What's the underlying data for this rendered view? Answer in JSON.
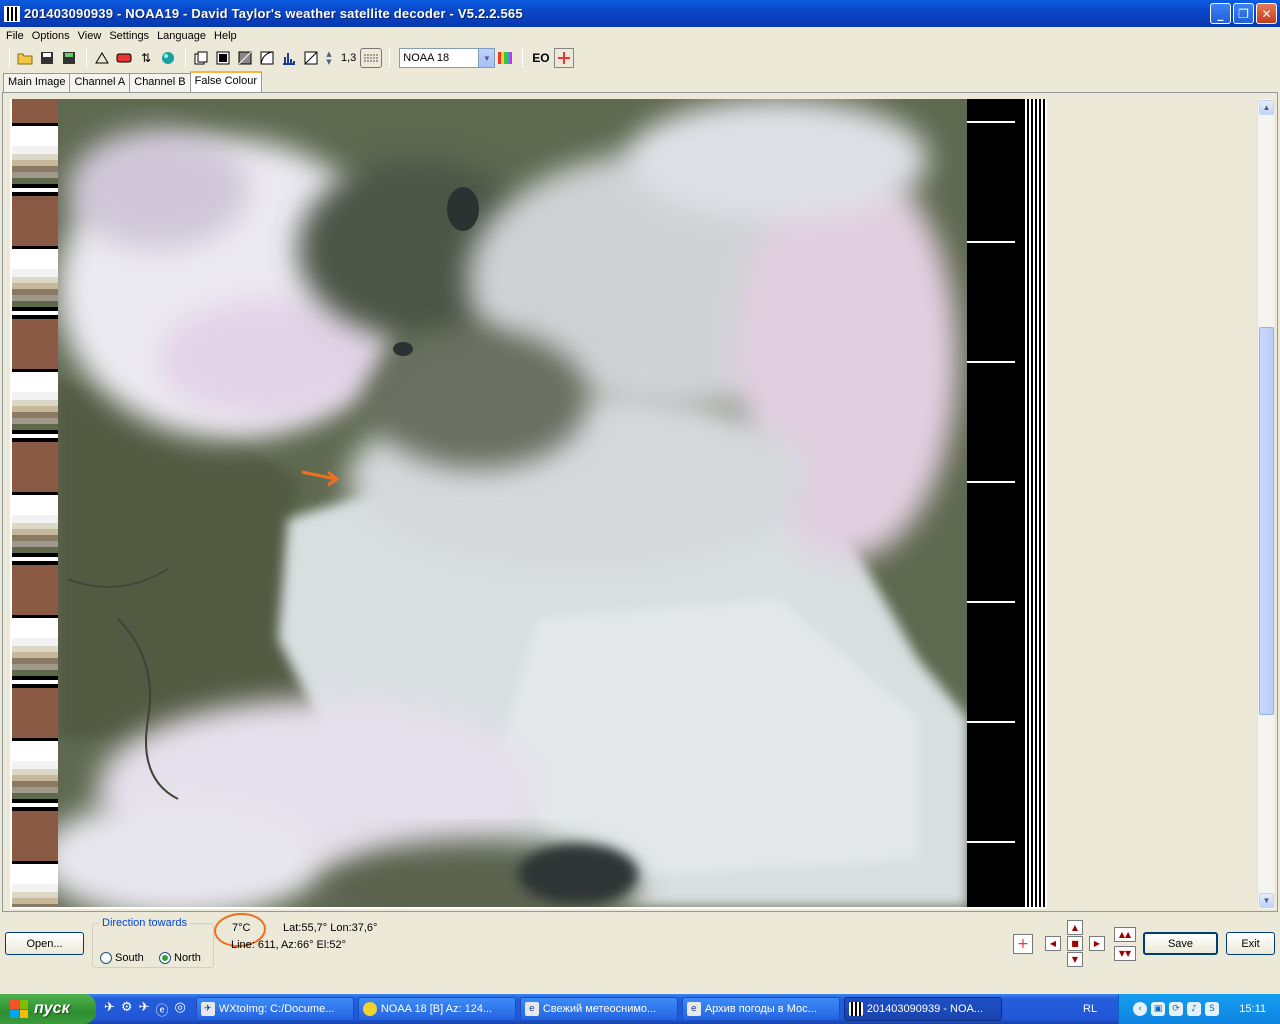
{
  "window": {
    "title": "201403090939 - NOAA19 - David Taylor's weather satellite decoder - V5.2.2.565",
    "buttons": {
      "minimize": "_",
      "restore": "❐",
      "close": "✕"
    }
  },
  "menu": [
    "File",
    "Options",
    "View",
    "Settings",
    "Language",
    "Help"
  ],
  "toolbar": {
    "gamma": "1,3",
    "satellite_select": "NOAA 18",
    "eo_label": "EO"
  },
  "tabs": [
    {
      "label": "Main Image",
      "active": false
    },
    {
      "label": "Channel A",
      "active": false
    },
    {
      "label": "Channel B",
      "active": false
    },
    {
      "label": "False Colour",
      "active": true
    }
  ],
  "status": {
    "temperature": "7°C",
    "lat_lon": "Lat:55,7°  Lon:37,6°",
    "line_az_el": "Line: 611,  Az:66°  El:52°"
  },
  "direction": {
    "title": "Direction towards",
    "south": "South",
    "north": "North",
    "selected": "North"
  },
  "buttons": {
    "open": "Open...",
    "save": "Save",
    "exit": "Exit"
  },
  "taskbar": {
    "start": "пуск",
    "tasks": [
      {
        "label": "WXtoImg: C:/Docume...",
        "active": false
      },
      {
        "label": "NOAA 18 [B]  Az: 124...",
        "active": false
      },
      {
        "label": "Свежий метеоснимо...",
        "active": false
      },
      {
        "label": "Архив погоды в Мос...",
        "active": false
      },
      {
        "label": "201403090939 - NOA...",
        "active": true
      }
    ],
    "lang": "RL",
    "clock": "15:11"
  },
  "colors": {
    "title_bar": "#0a46c8",
    "annotation": "#f07020",
    "taskbar": "#245edb"
  }
}
